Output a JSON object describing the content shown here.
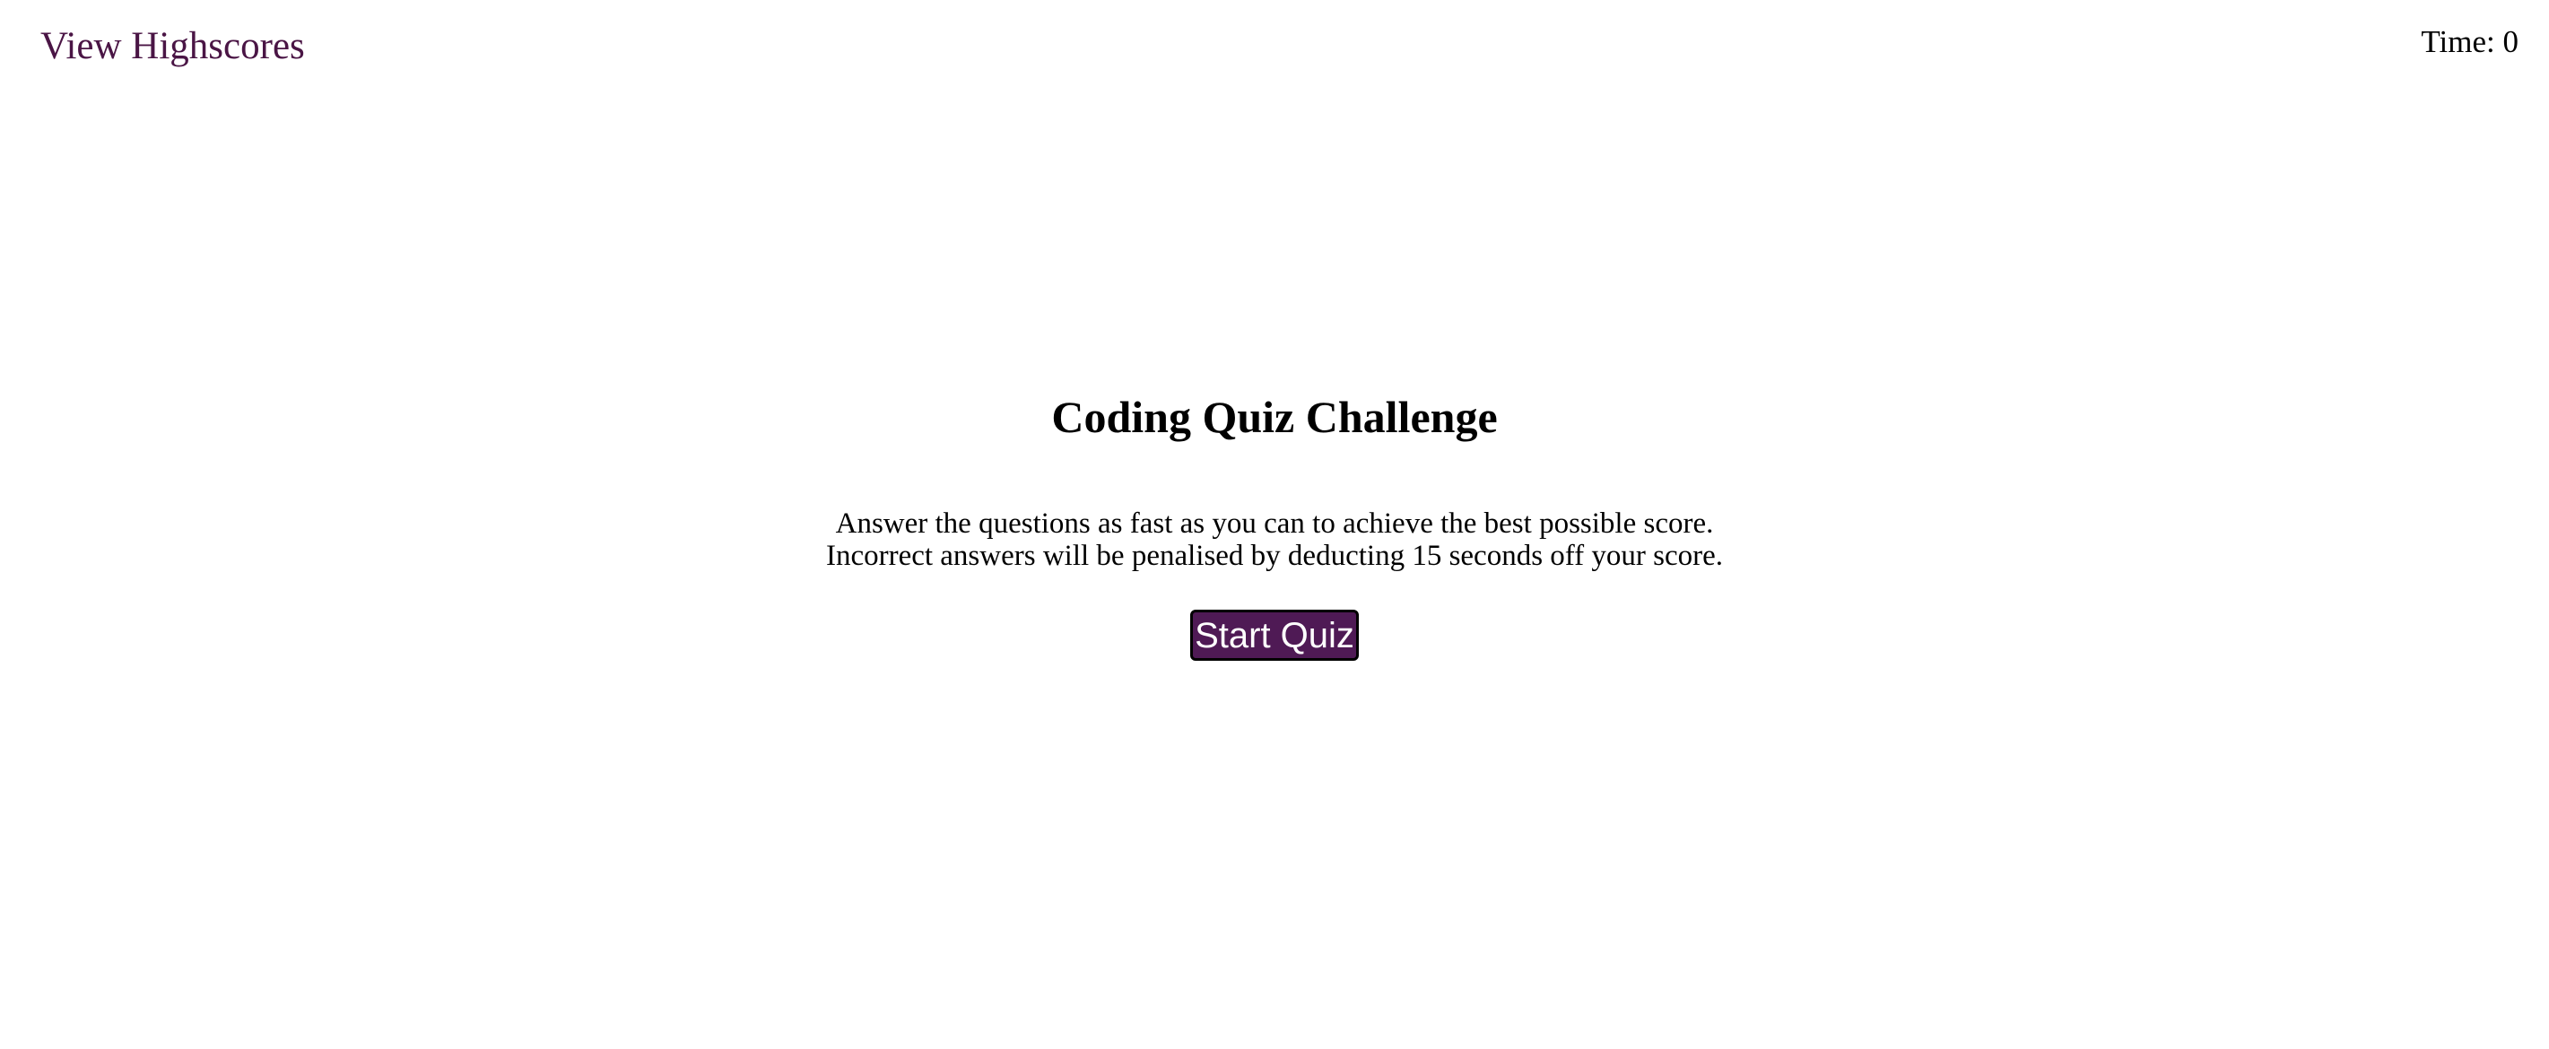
{
  "header": {
    "highscores_link": "View Highscores",
    "timer": "Time: 0"
  },
  "main": {
    "title": "Coding Quiz Challenge",
    "description_line1": "Answer the questions as fast as you can to achieve the best possible score.",
    "description_line2": "Incorrect answers will be penalised by deducting 15 seconds off your score.",
    "start_button": "Start Quiz"
  },
  "colors": {
    "accent": "#4f1a55",
    "link": "#4a1545",
    "text": "#000000",
    "background": "#ffffff"
  }
}
